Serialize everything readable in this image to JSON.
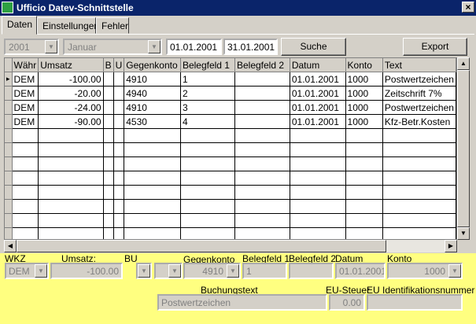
{
  "window": {
    "title": "Ufficio Datev-Schnittstelle",
    "close": "×"
  },
  "tabs": [
    "Daten",
    "Einstellungen",
    "Fehler"
  ],
  "toolbar": {
    "year": "2001",
    "month": "Januar",
    "date_from": "01.01.2001",
    "date_to": "31.01.2001",
    "search_label": "Suche",
    "export_label": "Export"
  },
  "grid": {
    "headers": [
      "Währ",
      "Umsatz",
      "B",
      "U",
      "Gegenkonto",
      "Belegfeld 1",
      "Belegfeld 2",
      "Datum",
      "Konto",
      "Text"
    ],
    "rows": [
      [
        "DEM",
        "-100.00",
        "",
        "",
        "4910",
        "1",
        "",
        "01.01.2001",
        "1000",
        "Postwertzeichen"
      ],
      [
        "DEM",
        "-20.00",
        "",
        "",
        "4940",
        "2",
        "",
        "01.01.2001",
        "1000",
        "Zeitschrift 7%"
      ],
      [
        "DEM",
        "-24.00",
        "",
        "",
        "4910",
        "3",
        "",
        "01.01.2001",
        "1000",
        "Postwertzeichen"
      ],
      [
        "DEM",
        "-90.00",
        "",
        "",
        "4530",
        "4",
        "",
        "01.01.2001",
        "1000",
        "Kfz-Betr.Kosten"
      ]
    ],
    "current_row_marker": "▸"
  },
  "detail": {
    "labels": {
      "wkz": "WKZ",
      "umsatz": "Umsatz:",
      "bu": "BU",
      "gegenkonto": "Gegenkonto",
      "belegfeld1": "Belegfeld 1",
      "belegfeld2": "Belegfeld 2",
      "datum": "Datum",
      "konto": "Konto",
      "buchungstext": "Buchungstext",
      "eu_steuer": "EU-Steuer",
      "eu_id": "EU Identifikationsnummer"
    },
    "values": {
      "wkz": "DEM",
      "umsatz": "-100.00",
      "gegenkonto": "4910",
      "belegfeld1": "1",
      "belegfeld2": "",
      "datum": "01.01.2001",
      "konto": "1000",
      "buchungstext": "Postwertzeichen",
      "eu_steuer": "0.00",
      "eu_id": ""
    }
  },
  "colors": {
    "title_bar": "#0a246a",
    "detail_bg": "#ffff80",
    "face": "#d4d0c8"
  }
}
